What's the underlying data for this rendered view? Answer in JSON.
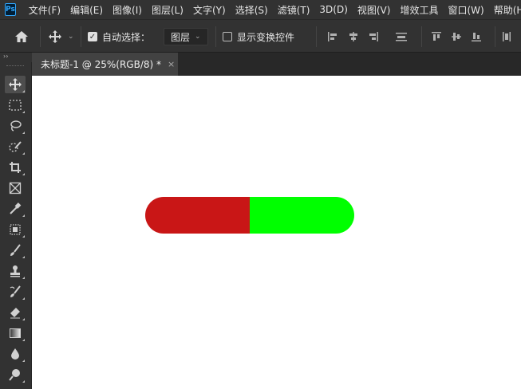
{
  "app": {
    "logo_text": "Ps"
  },
  "menu": [
    "文件(F)",
    "编辑(E)",
    "图像(I)",
    "图层(L)",
    "文字(Y)",
    "选择(S)",
    "滤镜(T)",
    "3D(D)",
    "视图(V)",
    "增效工具",
    "窗口(W)",
    "帮助(H)"
  ],
  "options": {
    "auto_select_label": "自动选择：",
    "auto_select_checked": true,
    "auto_select_target": "图层",
    "show_transform_label": "显示变换控件",
    "show_transform_checked": false
  },
  "panel": {
    "collapse_glyph": "››"
  },
  "document": {
    "tab_title": "未标题-1 @ 25%(RGB/8) *",
    "close_glyph": "×"
  },
  "canvas_content": {
    "left_color": "#c91616",
    "right_color": "#00ff00"
  },
  "tools": [
    "move-tool",
    "marquee-tool",
    "lasso-tool",
    "quick-selection-tool",
    "crop-tool",
    "frame-tool",
    "eyedropper-tool",
    "spot-healing-tool",
    "brush-tool",
    "clone-stamp-tool",
    "history-brush-tool",
    "eraser-tool",
    "gradient-tool",
    "blur-tool",
    "dodge-tool"
  ]
}
